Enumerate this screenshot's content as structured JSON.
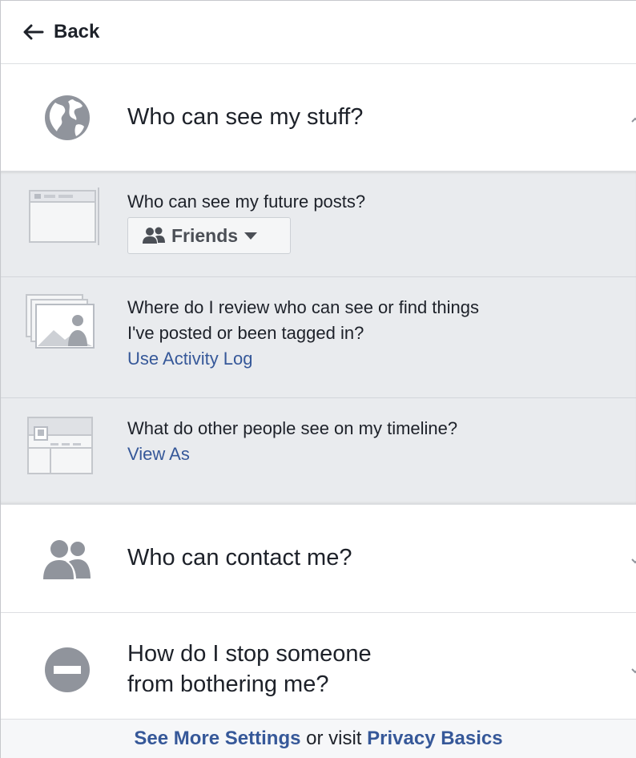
{
  "header": {
    "back_label": "Back"
  },
  "sections": {
    "stuff": {
      "title": "Who can see my stuff?",
      "icon": "globe-icon",
      "expanded": true,
      "items": {
        "future_posts": {
          "question": "Who can see my future posts?",
          "audience_label": "Friends",
          "icon": "future-posts-icon"
        },
        "activity_log": {
          "question_line1": "Where do I review who can see or find things",
          "question_line2": "I've posted or been tagged in?",
          "link": "Use Activity Log",
          "icon": "photo-stack-icon"
        },
        "view_as": {
          "question": "What do other people see on my timeline?",
          "link": "View As",
          "icon": "timeline-icon"
        }
      }
    },
    "contact": {
      "title": "Who can contact me?",
      "icon": "people-icon"
    },
    "stop": {
      "title_line1": "How do I stop someone",
      "title_line2": "from bothering me?",
      "icon": "block-icon"
    }
  },
  "footer": {
    "see_more": "See More Settings",
    "middle": " or visit ",
    "privacy_basics": "Privacy Basics"
  },
  "colors": {
    "link": "#365899",
    "expanded_bg": "#e9ebee",
    "icon_gray": "#90949c",
    "text": "#1d2129"
  }
}
